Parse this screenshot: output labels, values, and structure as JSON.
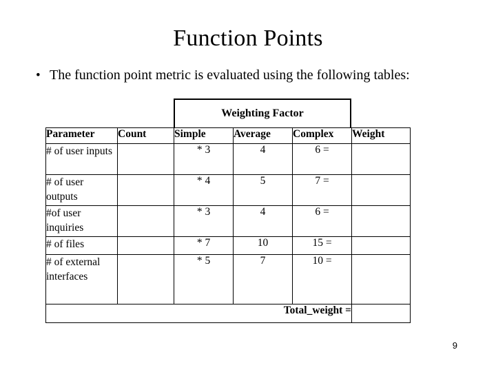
{
  "slide": {
    "title": "Function Points",
    "page_number": "9",
    "bullets": [
      {
        "glyph": "•",
        "text": "The function point metric is evaluated using the following tables:"
      }
    ]
  },
  "table": {
    "merged_header": "Weighting Factor",
    "columns": [
      "Parameter",
      "Count",
      "Simple",
      "Average",
      "Complex",
      "Weight"
    ],
    "rows": [
      {
        "parameter": "# of user inputs",
        "count": "",
        "simple": "* 3",
        "average": "4",
        "complex": "6 =",
        "weight": ""
      },
      {
        "parameter": "# of user outputs",
        "count": "",
        "simple": "*  4",
        "average": "5",
        "complex": "7 =",
        "weight": ""
      },
      {
        "parameter": "#of user inquiries",
        "count": "",
        "simple": "* 3",
        "average": "4",
        "complex": "6 =",
        "weight": ""
      },
      {
        "parameter": "# of files",
        "count": "",
        "simple": "* 7",
        "average": "10",
        "complex": "15 =",
        "weight": ""
      },
      {
        "parameter": "# of external interfaces",
        "count": "",
        "simple": "* 5",
        "average": "7",
        "complex": "10 =",
        "weight": ""
      }
    ],
    "total": {
      "label": "Total_weight =",
      "value": ""
    }
  },
  "colors": {
    "background": "#ffffff",
    "text": "#000000",
    "border": "#000000"
  }
}
